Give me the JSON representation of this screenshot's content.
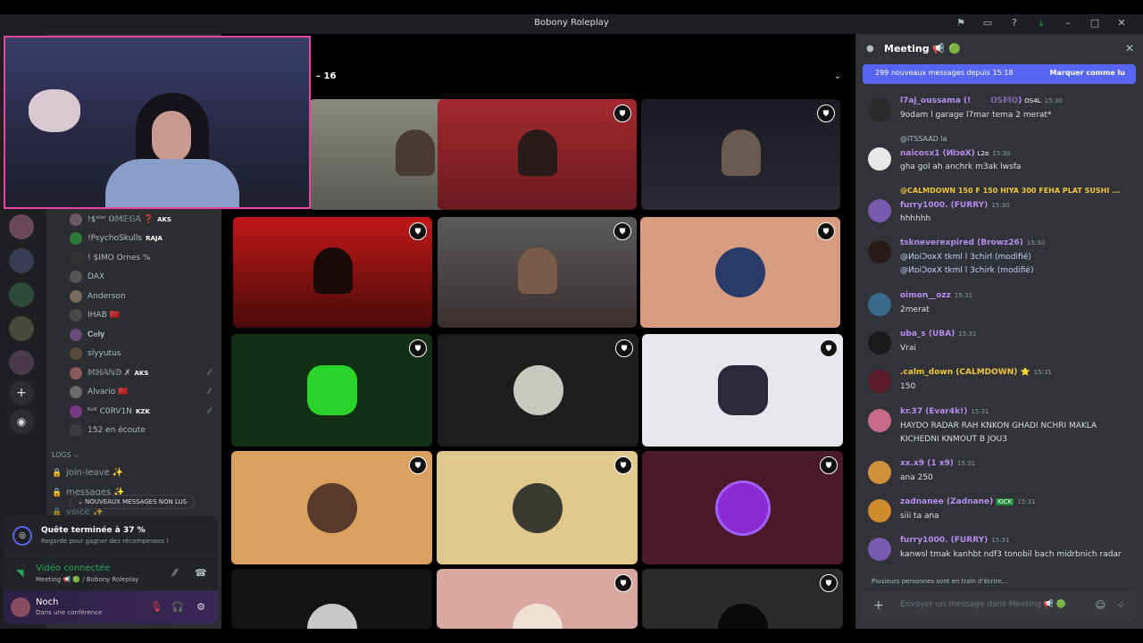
{
  "window": {
    "title": "Bobony Roleplay"
  },
  "titlebar_icons": [
    "flag-icon",
    "inbox-icon",
    "help-icon",
    "download-icon",
    "minimize-icon",
    "maximize-icon",
    "close-icon"
  ],
  "stage": {
    "count_label": "– 16"
  },
  "voice_users": [
    {
      "name": "!$ᵉˡᵒʳ 𝕆𝕄𝔼𝔾𝔸 ❓",
      "tag": "AKS",
      "muted": false
    },
    {
      "name": "!PsychoSkulls",
      "tag": "RAJA",
      "muted": false
    },
    {
      "name": "! $IMO Ornes %",
      "tag": "",
      "muted": false
    },
    {
      "name": "DAX",
      "tag": "",
      "muted": false
    },
    {
      "name": "Anderson",
      "tag": "",
      "muted": false
    },
    {
      "name": "IHAB 🇲🇦",
      "tag": "",
      "muted": false
    },
    {
      "name": "𝐂𝐞𝐥𝐲",
      "tag": "",
      "muted": false
    },
    {
      "name": "slyyutus",
      "tag": "",
      "muted": false
    },
    {
      "name": "𝕄ℍ𝔸ℕ𝔻 ✗",
      "tag": "AKS",
      "muted": true
    },
    {
      "name": "Alvario 🇲🇦",
      "tag": "",
      "muted": true
    },
    {
      "name": "ᴷᶻᴷ C0RV1N",
      "tag": "KZK",
      "muted": true
    },
    {
      "name": "152 en écoute",
      "tag": "",
      "muted": false
    }
  ],
  "category": "LOGS ⌵",
  "channels": [
    "join-leave ✨",
    "messages ✨",
    "voice ✨"
  ],
  "unread_pill": "⌄ NOUVEAUX MESSAGES NON LUS",
  "quest": {
    "title": "Quête terminée à 37 %",
    "subtitle": "Regarde pour gagner des récompenses !",
    "icon": "quest-icon"
  },
  "voice_status": {
    "label": "Vidéo connectée",
    "sub": "Meeting 📢 🟢 / Bobony Roleplay"
  },
  "user": {
    "name": "Noch",
    "status": "Dans une conférence"
  },
  "chat": {
    "title": "Meeting 📢 🟢",
    "new_messages": "299 nouveaux messages depuis 15:18",
    "mark_read": "Marquer comme lu",
    "typing": "Plusieurs personnes sont en train d'écrire...",
    "placeholder": "Envoyer un message dans Meeting 📢 🟢",
    "messages": [
      {
        "reply": "",
        "author": "l7aj_oussama (! ⁣ ⁣ ⁣ ⁣ ⁣ ⁣ 𝕆𝕊𝕄𝕆)",
        "badge": "OS4L",
        "time": "15:30",
        "color": "#b98cf0",
        "body": "9odam l garage l7mar tema 2 merat*"
      },
      {
        "reply": "@ITSSAAD la",
        "author": "naicosx1 (И𝐢ɔ𝐨Ⅹ)",
        "badge": "L2ɒ",
        "time": "15:30",
        "color": "#b98cf0",
        "body": "gha gol ah anchrk m3ak lwsfa"
      },
      {
        "reply": "@CALMDOWN 150 F 150  HIYA 300 FEHA PLAT SUSHI ...",
        "author": "furry1000. (FURRY)",
        "badge": "",
        "time": "15:30",
        "color": "#b98cf0",
        "body": "hhhhhh"
      },
      {
        "reply": "",
        "author": "tskneverexpired (Browz26)",
        "badge": "",
        "time": "15:30",
        "color": "#b98cf0",
        "body": "@ИɒiƆoxX tkml l 3chirl (modifié)\n@ИɒiƆoxX tkml l 3chirk (modifié)"
      },
      {
        "reply": "",
        "author": "oimon__ozz",
        "badge": "",
        "time": "15:31",
        "color": "#b98cf0",
        "body": "2merat"
      },
      {
        "reply": "",
        "author": "uba_s (UBA)",
        "badge": "",
        "time": "15:31",
        "color": "#b98cf0",
        "body": "Vrai"
      },
      {
        "reply": "",
        "author": ".calm_down (CALMDOWN) ⭐",
        "badge": "",
        "time": "15:31",
        "color": "#f0c640",
        "body": "150"
      },
      {
        "reply": "",
        "author": "kr.37 (Evar4k!)",
        "badge": "",
        "time": "15:31",
        "color": "#b98cf0",
        "body": "HAYDO RADAR RAH KNKON GHADI NCHRI MAKLA KICHEDNI KNMOUT B JOU3"
      },
      {
        "reply": "",
        "author": "xx.x9 (1 x9)",
        "badge": "",
        "time": "15:31",
        "color": "#b98cf0",
        "body": "ana 250"
      },
      {
        "reply": "",
        "author": "zadnanee (Zadnane)",
        "badge": "KICK",
        "time": "15:31",
        "color": "#b98cf0",
        "body": "siii ta ana"
      },
      {
        "reply": "",
        "author": "furry1000. (FURRY)",
        "badge": "",
        "time": "15:31",
        "color": "#b98cf0",
        "body": "kanwsl tmak kanhbt ndf3 tonobil bach midrbnich radar"
      }
    ]
  },
  "colors": {
    "accent": "#5865f2",
    "green": "#23a55a",
    "webcam_border": "#e8469e"
  }
}
